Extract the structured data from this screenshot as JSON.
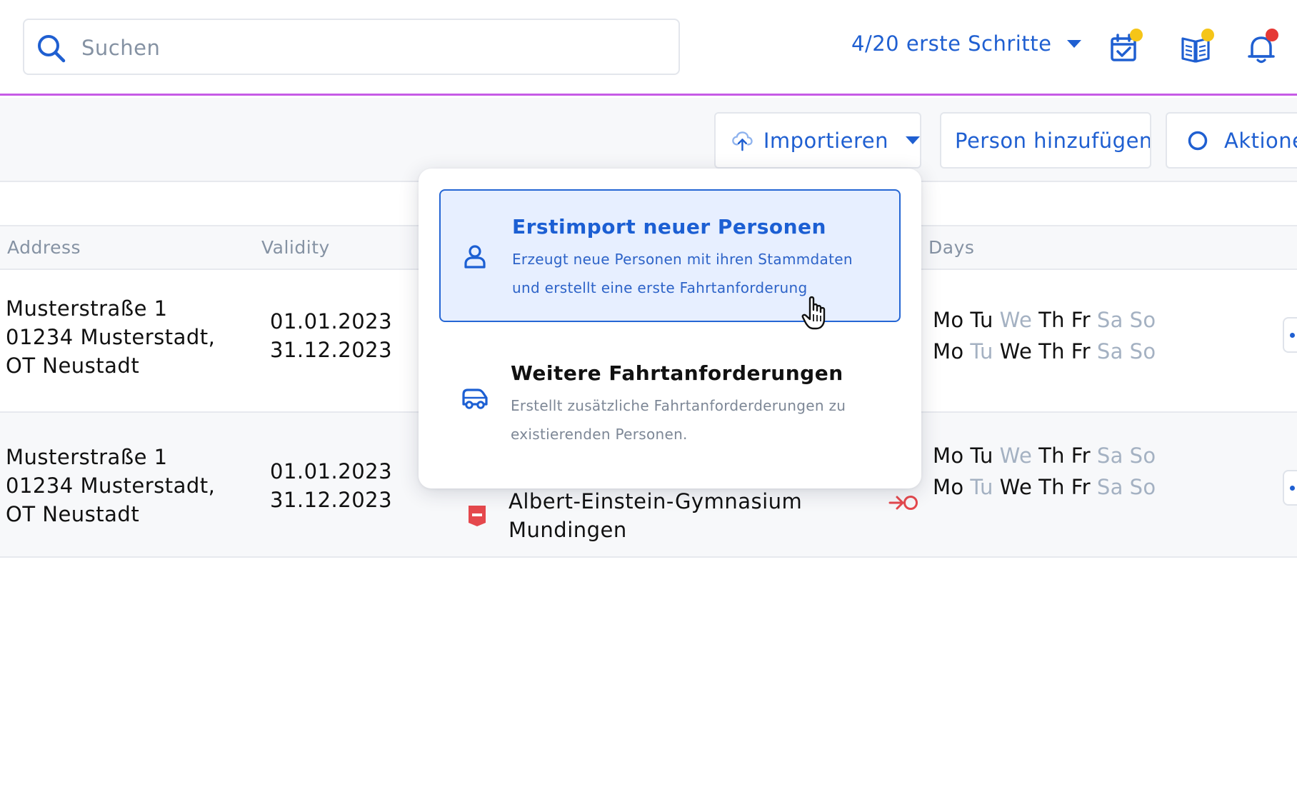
{
  "search": {
    "placeholder": "Suchen"
  },
  "header": {
    "onboarding_label": "4/20 erste Schritte",
    "icons": [
      "calendar-check-icon",
      "book-icon",
      "bell-icon"
    ],
    "badge_colors": {
      "calendar": "#f5c518",
      "book": "#f5c518",
      "bell": "#e53935"
    }
  },
  "toolbar": {
    "import_label": "Importieren",
    "add_person_label": "Person hinzufügen",
    "actions_label": "Aktionen"
  },
  "table": {
    "columns": {
      "address": "Address",
      "validity": "Validity",
      "days": "Days"
    },
    "rows": [
      {
        "address": [
          "Musterstraße 1",
          "01234 Musterstadt,",
          "OT Neustadt"
        ],
        "valid_from": "01.01.2023",
        "valid_to": "31.12.2023",
        "days_line1": [
          [
            "Mo",
            true
          ],
          [
            "Tu",
            true
          ],
          [
            "We",
            false
          ],
          [
            "Th",
            true
          ],
          [
            "Fr",
            true
          ],
          [
            "Sa",
            false
          ],
          [
            "So",
            false
          ]
        ],
        "days_line2": [
          [
            "Mo",
            true
          ],
          [
            "Tu",
            false
          ],
          [
            "We",
            true
          ],
          [
            "Th",
            true
          ],
          [
            "Fr",
            true
          ],
          [
            "Sa",
            false
          ],
          [
            "So",
            false
          ]
        ]
      },
      {
        "address": [
          "Musterstraße 1",
          "01234 Musterstadt,",
          "OT Neustadt"
        ],
        "valid_from": "01.01.2023",
        "valid_to": "31.12.2023",
        "school_line1": "Albert-Einstein-Gymnasium",
        "school_line2": "Mundingen",
        "days_line1": [
          [
            "Mo",
            true
          ],
          [
            "Tu",
            true
          ],
          [
            "We",
            false
          ],
          [
            "Th",
            true
          ],
          [
            "Fr",
            true
          ],
          [
            "Sa",
            false
          ],
          [
            "So",
            false
          ]
        ],
        "days_line2": [
          [
            "Mo",
            true
          ],
          [
            "Tu",
            false
          ],
          [
            "We",
            true
          ],
          [
            "Th",
            true
          ],
          [
            "Fr",
            true
          ],
          [
            "Sa",
            false
          ],
          [
            "So",
            false
          ]
        ]
      }
    ]
  },
  "import_menu": {
    "options": [
      {
        "title": "Erstimport neuer Personen",
        "description": "Erzeugt neue Personen mit ihren Stammdaten und erstellt eine erste Fahrtanforderung",
        "icon": "person-icon",
        "selected": true
      },
      {
        "title": "Weitere Fahrtanforderungen",
        "description": "Erstellt zusätzliche Fahrtanforderderungen zu existierenden Personen.",
        "icon": "car-icon",
        "selected": false
      }
    ]
  },
  "colors": {
    "accent": "#1f5fd1",
    "divider": "#c65be6",
    "muted": "#a4b1c2",
    "danger": "#e53935"
  }
}
